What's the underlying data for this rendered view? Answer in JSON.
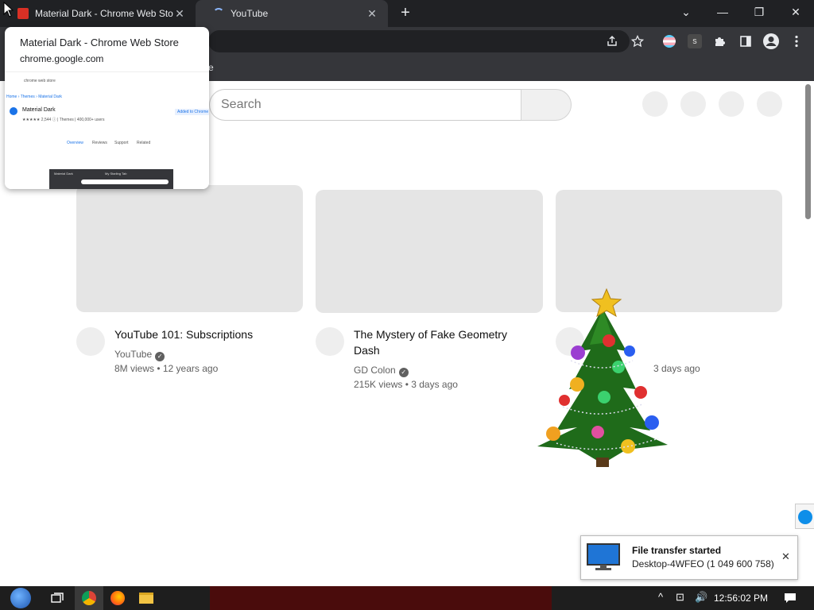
{
  "browser": {
    "tabs": [
      {
        "title": "Material Dark - Chrome Web Store",
        "close": "✕"
      },
      {
        "title": "YouTube",
        "close": "✕"
      }
    ],
    "new_tab": "+",
    "controls": {
      "dropdown": "⌄",
      "minimize": "—",
      "restore": "❐",
      "close": "✕"
    },
    "toolbar_icons": [
      "share-icon",
      "star-icon",
      "profile-flag-icon",
      "extension-s-icon",
      "puzzle-icon",
      "sidepanel-icon",
      "account-icon",
      "menu-icon"
    ],
    "extension_letter": "s",
    "bookmark_fragment": "e"
  },
  "hover_card": {
    "title": "Material Dark - Chrome Web Store",
    "url": "chrome.google.com",
    "preview": {
      "search": "chrome web store",
      "breadcrumb": "Home › Themes › Material Dark",
      "item_name": "Material Dark",
      "rating": "★★★★★ 2,544 ⓘ | Themes | 400,000+ users",
      "add_button": "Added to Chrome",
      "tabs": [
        "Overview",
        "Reviews",
        "Support",
        "Related"
      ],
      "shot_tab_1": "Material Dark",
      "shot_tab_2": "My Starling Tab"
    }
  },
  "youtube": {
    "search_placeholder": "Search",
    "videos": [
      {
        "title": "YouTube 101: Subscriptions",
        "channel": "YouTube",
        "stats": "8M views • 12 years ago"
      },
      {
        "title": "The Mystery of Fake Geometry Dash",
        "channel": "GD Colon",
        "stats": "215K views • 3 days ago"
      },
      {
        "stats_fragment": "3 days ago"
      }
    ]
  },
  "notification": {
    "title": "File transfer started",
    "subtitle": "Desktop-4WFEO (1 049 600 758)",
    "close": "✕"
  },
  "taskbar": {
    "clock": "12:56:02 PM",
    "tray": [
      "^",
      "⊡",
      "🔊"
    ]
  }
}
